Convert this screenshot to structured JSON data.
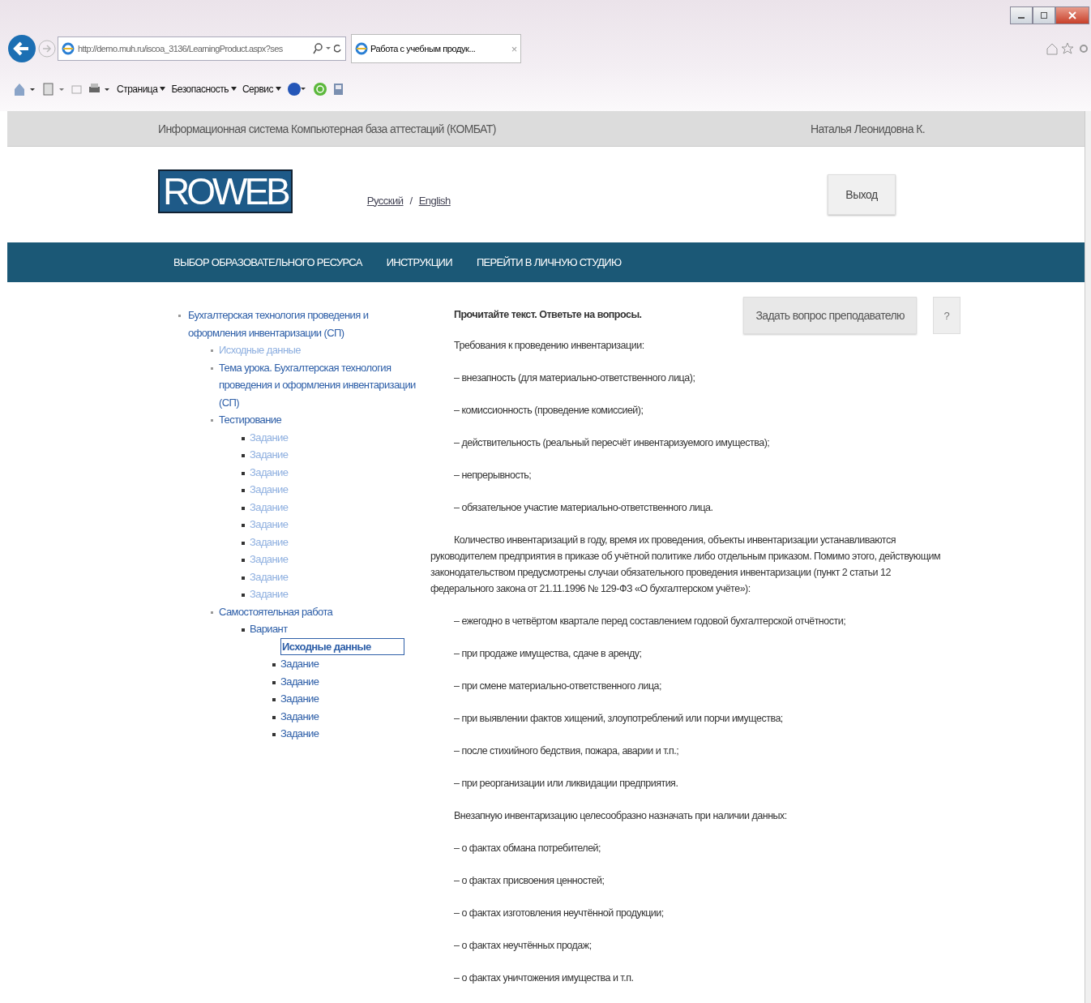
{
  "browser": {
    "url": "http://demo.muh.ru/iscoa_3136/LearningProduct.aspx?ses",
    "tab_title": "Работа с учебным продук...",
    "tab_close": "×",
    "toolbar_menus": [
      "Страница",
      "Безопасность",
      "Сервис"
    ]
  },
  "header": {
    "system_title": "Информационная система Компьютерная база аттестаций (КОМБАТ)",
    "user_name": "Наталья Леонидовна К."
  },
  "branding": {
    "logo": "ROWEB",
    "languages": [
      "Русский",
      "English"
    ],
    "language_separator": "/",
    "logout_button": "Выход"
  },
  "nav": [
    "ВЫБОР ОБРАЗОВАТЕЛЬНОГО РЕСУРСА",
    "ИНСТРУКЦИИ",
    "ПЕРЕЙТИ В ЛИЧНУЮ СТУДИЮ"
  ],
  "tree": [
    {
      "label": "Бухгалтерская технология проведения и оформления инвентаризации (СП)",
      "visited": false,
      "selected": false,
      "children": [
        {
          "label": "Исходные данные",
          "visited": true,
          "selected": false
        },
        {
          "label": "Тема урока. Бухгалтерская технология проведения и оформления инвентаризации (СП)",
          "visited": false,
          "selected": false
        },
        {
          "label": "Тестирование",
          "visited": false,
          "selected": false,
          "children": [
            {
              "label": "Задание",
              "visited": true,
              "selected": false
            },
            {
              "label": "Задание",
              "visited": true,
              "selected": false
            },
            {
              "label": "Задание",
              "visited": true,
              "selected": false
            },
            {
              "label": "Задание",
              "visited": true,
              "selected": false
            },
            {
              "label": "Задание",
              "visited": true,
              "selected": false
            },
            {
              "label": "Задание",
              "visited": true,
              "selected": false
            },
            {
              "label": "Задание",
              "visited": true,
              "selected": false
            },
            {
              "label": "Задание",
              "visited": true,
              "selected": false
            },
            {
              "label": "Задание",
              "visited": true,
              "selected": false
            },
            {
              "label": "Задание",
              "visited": true,
              "selected": false
            }
          ]
        },
        {
          "label": "Самостоятельная работа",
          "visited": false,
          "selected": false,
          "children": [
            {
              "label": "Вариант",
              "visited": false,
              "selected": false,
              "children": [
                {
                  "label": "Исходные данные",
                  "visited": false,
                  "selected": true
                },
                {
                  "label": "Задание",
                  "visited": false,
                  "selected": false
                },
                {
                  "label": "Задание",
                  "visited": false,
                  "selected": false
                },
                {
                  "label": "Задание",
                  "visited": false,
                  "selected": false
                },
                {
                  "label": "Задание",
                  "visited": false,
                  "selected": false
                },
                {
                  "label": "Задание",
                  "visited": false,
                  "selected": false
                }
              ]
            }
          ]
        }
      ]
    }
  ],
  "actions": {
    "ask_button": "Задать вопрос преподавателю",
    "help_button": "?"
  },
  "content": [
    {
      "kind": "heading",
      "text": "Прочитайте текст. Ответьте на вопросы."
    },
    {
      "kind": "text",
      "text": "Требования к проведению инвентаризации:"
    },
    {
      "kind": "item",
      "text": "– внезапность (для материально-ответственного лица);"
    },
    {
      "kind": "item",
      "text": "– комиссионность (проведение комиссией);"
    },
    {
      "kind": "item",
      "text": "– действительность (реальный пересчёт инвентаризуемого имущества);"
    },
    {
      "kind": "item",
      "text": "– непрерывность;"
    },
    {
      "kind": "item",
      "text": "– обязательное участие материально-ответственного лица."
    },
    {
      "kind": "paragraph",
      "text": "Количество инвентаризаций в году, время их проведения, объекты инвентаризации устанавливаются руководителем предприятия в приказе об учётной политике либо отдельным приказом. Помимо этого, действующим законодательством предусмотрены случаи обязательного проведения инвентаризации (пункт 2 статьи 12 федерального закона от 21.11.1996 № 129-ФЗ «О бухгалтерском учёте»):"
    },
    {
      "kind": "item",
      "text": "– ежегодно в четвёртом квартале перед составлением годовой бухгалтерской отчётности;"
    },
    {
      "kind": "item",
      "text": "– при продаже имущества, сдаче в аренду;"
    },
    {
      "kind": "item",
      "text": "– при смене материально-ответственного лица;"
    },
    {
      "kind": "item",
      "text": "– при выявлении фактов хищений, злоупотреблений или порчи имущества;"
    },
    {
      "kind": "item",
      "text": "– после стихийного бедствия, пожара, аварии и т.п.;"
    },
    {
      "kind": "item",
      "text": "– при реорганизации или ликвидации предприятия."
    },
    {
      "kind": "text",
      "text": "Внезапную инвентаризацию целесообразно назначать при наличии данных:"
    },
    {
      "kind": "item",
      "text": "– о фактах обмана потребителей;"
    },
    {
      "kind": "item",
      "text": "– о фактах присвоения ценностей;"
    },
    {
      "kind": "item",
      "text": "– о фактах изготовления неучтённой продукции;"
    },
    {
      "kind": "item",
      "text": "– о фактах неучтённых продаж;"
    },
    {
      "kind": "item",
      "text": "– о фактах уничтожения имущества и т.п."
    }
  ]
}
